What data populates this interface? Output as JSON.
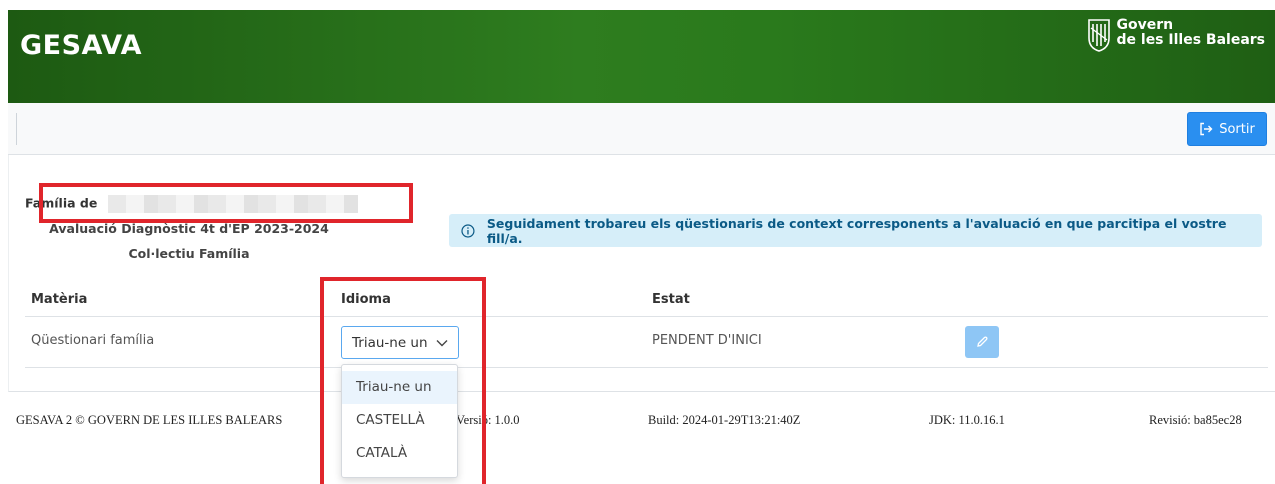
{
  "header": {
    "app_title": "GESAVA",
    "gov_line1": "Govern",
    "gov_line2": "de les Illes Balears"
  },
  "toolbar": {
    "logout_label": "Sortir"
  },
  "family": {
    "label": "Família de",
    "evaluation": "Avaluació Diagnòstic 4t d'EP 2023-2024",
    "collective": "Col·lectiu  Família"
  },
  "info": {
    "message": "Seguidament trobareu els qüestionaris de context corresponents a l'avaluació en que parcitipa el vostre fill/a."
  },
  "table": {
    "headers": [
      "Matèria",
      "Idioma",
      "Estat"
    ],
    "rows": [
      {
        "subject": "Qüestionari família",
        "language": "Triau-ne un",
        "status": "PENDENT D'INICI"
      }
    ]
  },
  "dropdown": {
    "options": [
      "Triau-ne un",
      "CASTELLÀ",
      "CATALÀ"
    ],
    "selected_index": 0
  },
  "footer": {
    "copyright": "GESAVA 2 © GOVERN DE LES ILLES BALEARS",
    "version": "Versió:  1.0.0",
    "build": "Build:  2024-01-29T13:21:40Z",
    "jdk": "JDK:  11.0.16.1",
    "revision": "Revisió:  ba85ec28"
  },
  "colors": {
    "header_green": "#2e7d1f",
    "primary_button": "#2a8ff0",
    "info_background": "#d6eef9",
    "highlight_red": "#e0252b"
  }
}
